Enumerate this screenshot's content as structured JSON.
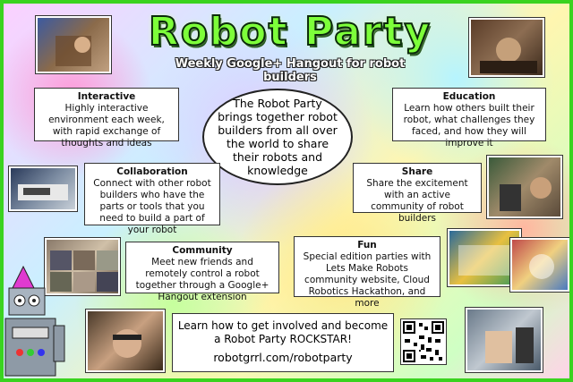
{
  "title": "Robot Party",
  "subtitle": "Weekly Google+ Hangout for robot builders",
  "center": "The Robot Party brings together robot builders from all over the world to share their robots and knowledge",
  "sections": {
    "interactive": {
      "heading": "Interactive",
      "text": "Highly interactive environment each week, with rapid exchange of thoughts and ideas"
    },
    "education": {
      "heading": "Education",
      "text": "Learn how others built their robot, what challenges they faced, and how they will improve it"
    },
    "collaboration": {
      "heading": "Collaboration",
      "text": "Connect with other robot builders who have the parts or tools that you need to build a part of your robot"
    },
    "share": {
      "heading": "Share",
      "text": "Share the excitement with an active community of robot builders"
    },
    "community": {
      "heading": "Community",
      "text": "Meet new friends and remotely control a robot together through a Google+ Hangout extension"
    },
    "fun": {
      "heading": "Fun",
      "text": "Special edition parties with Lets Make Robots community website, Cloud Robotics Hackathon, and more"
    }
  },
  "cta": {
    "text": "Learn how to get involved and become a Robot Party ROCKSTAR!",
    "url": "robotgrrl.com/robotparty"
  },
  "colors": {
    "border": "#3ad31f",
    "title": "#7dff3a"
  }
}
